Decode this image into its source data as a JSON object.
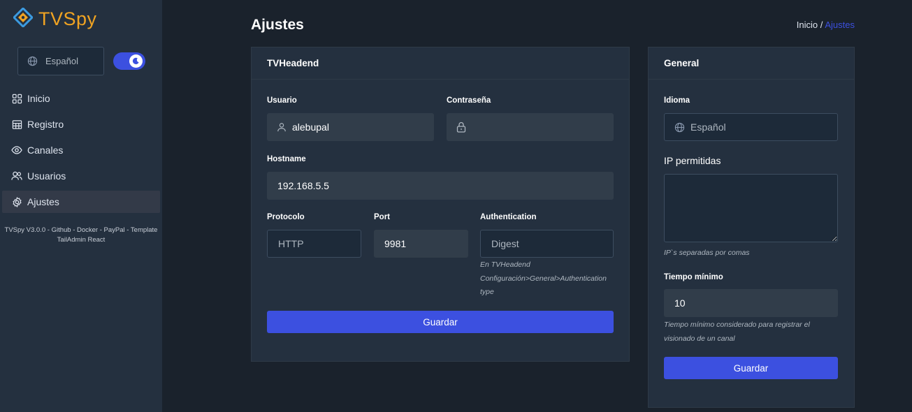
{
  "app": {
    "name": "TVSpy"
  },
  "colors": {
    "accent": "#3c50e0",
    "logo": "#f0a322",
    "sidebar_bg": "#24303f",
    "page_bg": "#1a222c"
  },
  "sidebar": {
    "language": "Español",
    "dark_mode": true,
    "items": [
      {
        "label": "Inicio",
        "icon": "grid-icon",
        "active": false
      },
      {
        "label": "Registro",
        "icon": "table-icon",
        "active": false
      },
      {
        "label": "Canales",
        "icon": "eye-icon",
        "active": false
      },
      {
        "label": "Usuarios",
        "icon": "users-icon",
        "active": false
      },
      {
        "label": "Ajustes",
        "icon": "gear-icon",
        "active": true
      }
    ],
    "footer_line1": "TVSpy V3.0.0 - Github - Docker - PayPal - Template",
    "footer_line2": "TailAdmin React"
  },
  "page": {
    "title": "Ajustes",
    "breadcrumb_home": "Inicio /",
    "breadcrumb_current": "Ajustes"
  },
  "tvheadend": {
    "title": "TVHeadend",
    "user_label": "Usuario",
    "user_value": "alebupal",
    "password_label": "Contraseña",
    "password_value": "",
    "hostname_label": "Hostname",
    "hostname_value": "192.168.5.5",
    "protocol_label": "Protocolo",
    "protocol_value": "HTTP",
    "port_label": "Port",
    "port_value": "9981",
    "auth_label": "Authentication",
    "auth_value": "Digest",
    "auth_hint_1": "En TVHeadend",
    "auth_hint_2": "Configuración>General>Authentication",
    "auth_hint_3": "type",
    "save_label": "Guardar"
  },
  "general": {
    "title": "General",
    "language_label": "Idioma",
    "language_value": "Español",
    "ips_label": "IP permitidas",
    "ips_value": "",
    "ips_hint": "IP`s separadas por comas",
    "min_time_label": "Tiempo mínimo",
    "min_time_value": "10",
    "min_time_hint_1": "Tiempo mínimo considerado para registrar el",
    "min_time_hint_2": "visionado de un canal",
    "save_label": "Guardar"
  }
}
